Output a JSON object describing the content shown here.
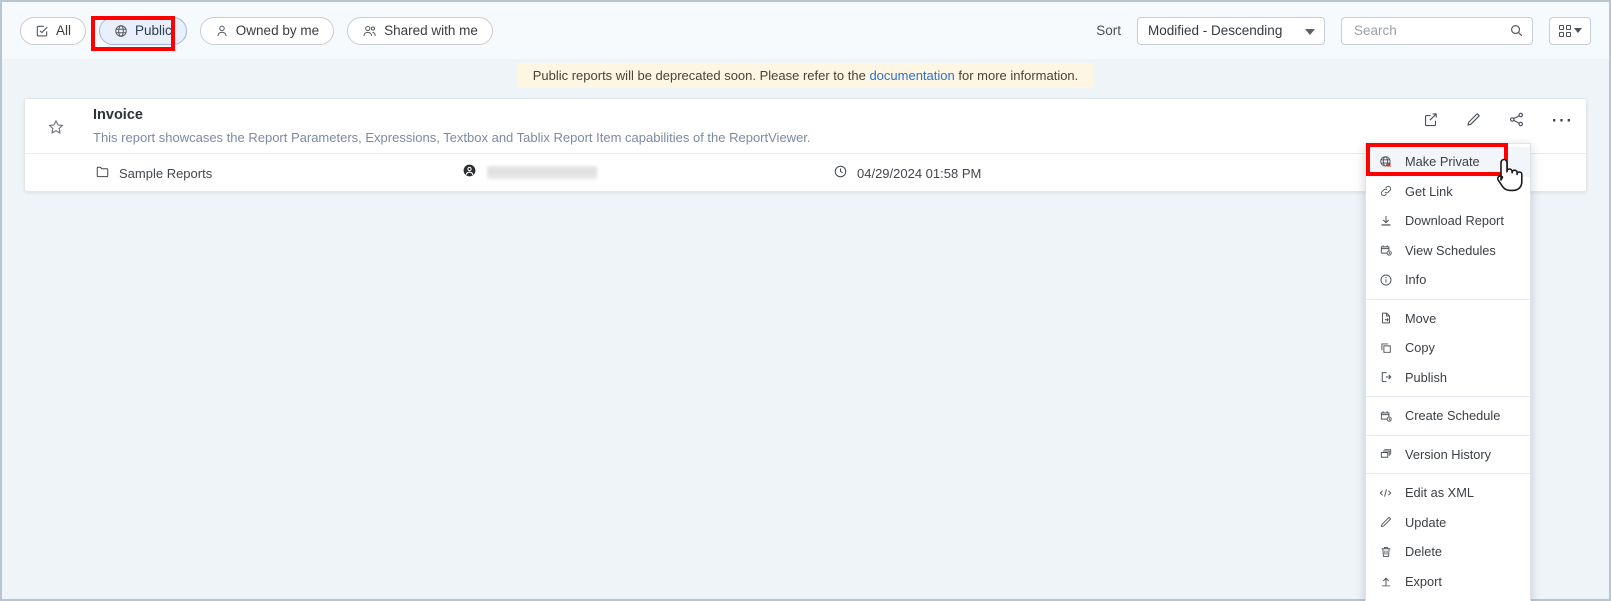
{
  "toolbar": {
    "filters": [
      {
        "label": "All",
        "icon": "checkbox-icon",
        "selected": false
      },
      {
        "label": "Public",
        "icon": "globe-icon",
        "selected": true
      },
      {
        "label": "Owned by me",
        "icon": "person-icon",
        "selected": false
      },
      {
        "label": "Shared with me",
        "icon": "people-icon",
        "selected": false
      }
    ],
    "sort_label": "Sort",
    "sort_value": "Modified - Descending",
    "search_placeholder": "Search",
    "search_value": "",
    "search_icon": "search-icon",
    "view_icon": "grid-view-icon"
  },
  "banner": {
    "text_before": "Public reports will be deprecated soon. Please refer to the ",
    "link_text": "documentation",
    "text_after": " for more information.",
    "background": "#fdf6e3",
    "link_color": "#2f6fd0"
  },
  "report": {
    "title": "Invoice",
    "description": "This report showcases the Report Parameters, Expressions, Textbox and Tablix Report Item capabilities of the ReportViewer.",
    "favorite_icon": "star-outline-icon",
    "folder": "Sample Reports",
    "folder_icon": "folder-icon",
    "owner": "",
    "owner_icon": "account-circle-icon",
    "owner_redacted": true,
    "modified": "04/29/2024 01:58 PM",
    "clock_icon": "clock-icon",
    "actions": [
      {
        "name": "open-new-tab-icon",
        "title": "Open"
      },
      {
        "name": "edit-pencil-icon",
        "title": "Edit"
      },
      {
        "name": "share-icon",
        "title": "Share"
      },
      {
        "name": "more-options-icon",
        "title": "More"
      }
    ]
  },
  "context_menu": {
    "items": [
      {
        "label": "Make Private",
        "icon": "globe-private-icon",
        "active": true,
        "separator_after": false
      },
      {
        "label": "Get Link",
        "icon": "link-icon",
        "active": false,
        "separator_after": false
      },
      {
        "label": "Download Report",
        "icon": "download-icon",
        "active": false,
        "separator_after": false
      },
      {
        "label": "View Schedules",
        "icon": "calendar-clock-icon",
        "active": false,
        "separator_after": false
      },
      {
        "label": "Info",
        "icon": "info-circle-icon",
        "active": false,
        "separator_after": true
      },
      {
        "label": "Move",
        "icon": "move-file-icon",
        "active": false,
        "separator_after": false
      },
      {
        "label": "Copy",
        "icon": "copy-icon",
        "active": false,
        "separator_after": false
      },
      {
        "label": "Publish",
        "icon": "publish-icon",
        "active": false,
        "separator_after": true
      },
      {
        "label": "Create Schedule",
        "icon": "calendar-clock-icon",
        "active": false,
        "separator_after": true
      },
      {
        "label": "Version History",
        "icon": "layers-icon",
        "active": false,
        "separator_after": true
      },
      {
        "label": "Edit as XML",
        "icon": "code-icon",
        "active": false,
        "separator_after": false
      },
      {
        "label": "Update",
        "icon": "pencil-icon",
        "active": false,
        "separator_after": false
      },
      {
        "label": "Delete",
        "icon": "trash-icon",
        "active": false,
        "separator_after": false
      },
      {
        "label": "Export",
        "icon": "export-icon",
        "active": false,
        "separator_after": false
      }
    ]
  },
  "annotations": {
    "highlight_color": "#ff0000",
    "boxes": [
      {
        "target": "public-filter-pill"
      },
      {
        "target": "menu-item-make-private"
      }
    ],
    "cursor": "pointer-hand-cursor"
  }
}
